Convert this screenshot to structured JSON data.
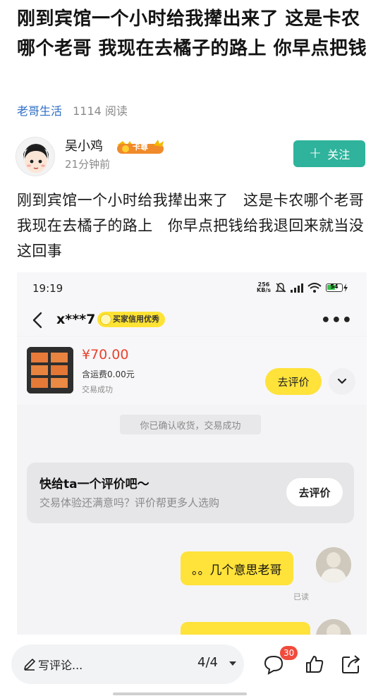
{
  "article": {
    "headline": "刚到宾馆一个小时给我撵出来了 这是卡农哪个老哥 我现在去橘子的路上 你早点把钱",
    "channel": "老哥生活",
    "reads": "1114 阅读",
    "body": "刚到宾馆一个小时给我撵出来了　这是卡农哪个老哥　我现在去橘子的路上　你早点把钱给我退回来就当没这回事"
  },
  "author": {
    "name": "吴小鸡",
    "badge": "卡尊",
    "time": "21分钟前",
    "follow_label": "关注",
    "follow_plus": "+"
  },
  "screenshot": {
    "status_time": "19:19",
    "net_speed_value": "256",
    "net_speed_unit": "KB/s",
    "battery": "54",
    "chat_user": "x***7",
    "credit_badge": "买家信用优秀",
    "more": "•••",
    "order": {
      "price": "¥70.00",
      "shipping": "含运费0.00元",
      "status": "交易成功",
      "review_button": "去评价"
    },
    "system_message": "你已确认收货，交易成功",
    "prompt": {
      "title": "快给ta一个评价吧～",
      "subtitle": "交易体验还满意吗？评价帮更多人选购",
      "button": "去评价"
    },
    "message": "。。几个意思老哥",
    "read_label": "已读"
  },
  "bottom_bar": {
    "comment_placeholder": "写评论...",
    "page_indicator": "4/4",
    "comment_count": "30"
  },
  "colors": {
    "follow": "#2fb39c",
    "channel": "#2d6dc6",
    "price": "#e8432e",
    "accent_yellow": "#ffe23a",
    "badge_red": "#f04b3c"
  },
  "icons": [
    "avatar",
    "crown-badge",
    "back-icon",
    "more-icon",
    "chevron-down-icon",
    "pencil-icon",
    "comment-icon",
    "like-icon",
    "share-icon",
    "wifi-icon",
    "mute-icon",
    "battery-icon"
  ]
}
